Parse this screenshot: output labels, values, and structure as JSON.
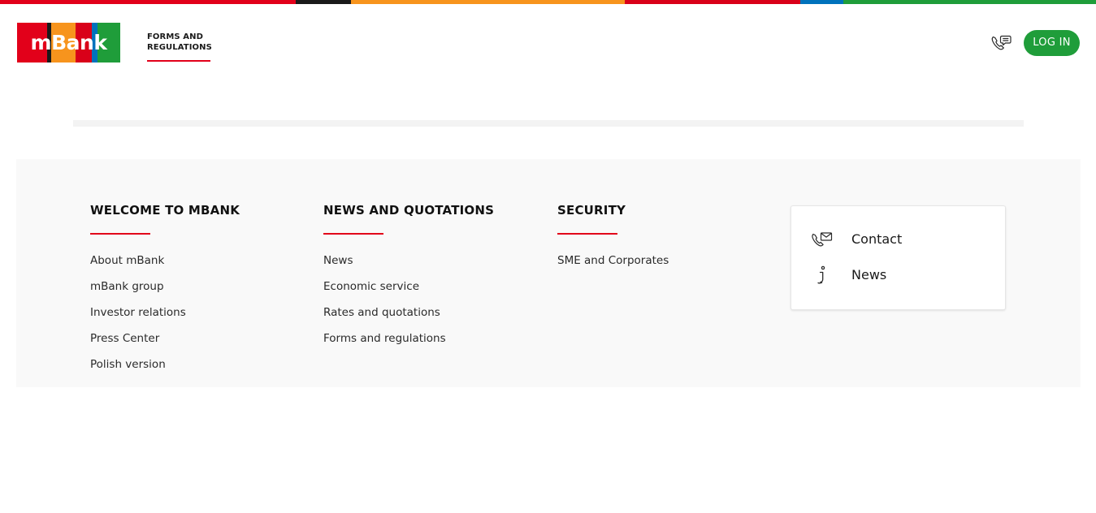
{
  "brand": {
    "logo_text": "mBank",
    "stripe_colors": [
      "#e2001a",
      "#1a1a1a",
      "#f7941d",
      "#d90019",
      "#0072bc",
      "#1f9d3a"
    ],
    "logo_colors": [
      "#e2001a",
      "#1a1a1a",
      "#f7941d",
      "#d90019",
      "#0072bc",
      "#1f9d3a"
    ]
  },
  "header": {
    "nav_item": "FORMS AND REGULATIONS",
    "phone_icon": "phone-chat-icon",
    "login_label": "LOG IN",
    "accent": "#e2001a",
    "login_color": "#1f9d3a"
  },
  "footer": {
    "columns": [
      {
        "title": "WELCOME TO MBANK",
        "links": [
          "About mBank",
          "mBank group",
          "Investor relations",
          "Press Center",
          "Polish version"
        ]
      },
      {
        "title": "NEWS AND QUOTATIONS",
        "links": [
          "News",
          "Economic service",
          "Rates and quotations",
          "Forms and regulations"
        ]
      },
      {
        "title": "SECURITY",
        "links": [
          "SME and Corporates"
        ]
      }
    ],
    "card": {
      "items": [
        {
          "label": "Contact",
          "icon": "phone-envelope-icon"
        },
        {
          "label": "News",
          "icon": "info-icon"
        }
      ]
    }
  }
}
